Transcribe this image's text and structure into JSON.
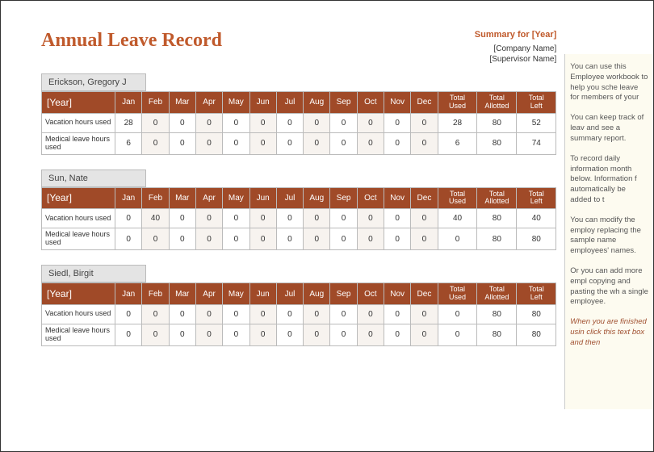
{
  "title": "Annual Leave Record",
  "summary_label": "Summary for [Year]",
  "company": "[Company Name]",
  "supervisor": "[Supervisor Name]",
  "year_header": "[Year]",
  "months": [
    "Jan",
    "Feb",
    "Mar",
    "Apr",
    "May",
    "Jun",
    "Jul",
    "Aug",
    "Sep",
    "Oct",
    "Nov",
    "Dec"
  ],
  "total_headers": [
    "Total Used",
    "Total Allotted",
    "Total Left"
  ],
  "row_labels": [
    "Vacation hours used",
    "Medical leave hours used"
  ],
  "employees": [
    {
      "name": "Erickson, Gregory J",
      "rows": [
        {
          "m": [
            28,
            0,
            0,
            0,
            0,
            0,
            0,
            0,
            0,
            0,
            0,
            0
          ],
          "t": [
            28,
            80,
            52
          ]
        },
        {
          "m": [
            6,
            0,
            0,
            0,
            0,
            0,
            0,
            0,
            0,
            0,
            0,
            0
          ],
          "t": [
            6,
            80,
            74
          ]
        }
      ]
    },
    {
      "name": "Sun, Nate",
      "rows": [
        {
          "m": [
            0,
            40,
            0,
            0,
            0,
            0,
            0,
            0,
            0,
            0,
            0,
            0
          ],
          "t": [
            40,
            80,
            40
          ]
        },
        {
          "m": [
            0,
            0,
            0,
            0,
            0,
            0,
            0,
            0,
            0,
            0,
            0,
            0
          ],
          "t": [
            0,
            80,
            80
          ]
        }
      ]
    },
    {
      "name": "Siedl, Birgit",
      "rows": [
        {
          "m": [
            0,
            0,
            0,
            0,
            0,
            0,
            0,
            0,
            0,
            0,
            0,
            0
          ],
          "t": [
            0,
            80,
            80
          ]
        },
        {
          "m": [
            0,
            0,
            0,
            0,
            0,
            0,
            0,
            0,
            0,
            0,
            0,
            0
          ],
          "t": [
            0,
            80,
            80
          ]
        }
      ]
    }
  ],
  "sidebar": [
    "You can use this Employee workbook to help you sche leave for members of your",
    "You can keep track of leav and see a summary report.",
    "To record daily information month below. Information f automatically be added to t",
    "You can modify the employ replacing the sample name employees' names.",
    "Or you can add more empl copying and pasting the wh a single employee."
  ],
  "sidebar_note": "When you are finished usin click this text box and then"
}
